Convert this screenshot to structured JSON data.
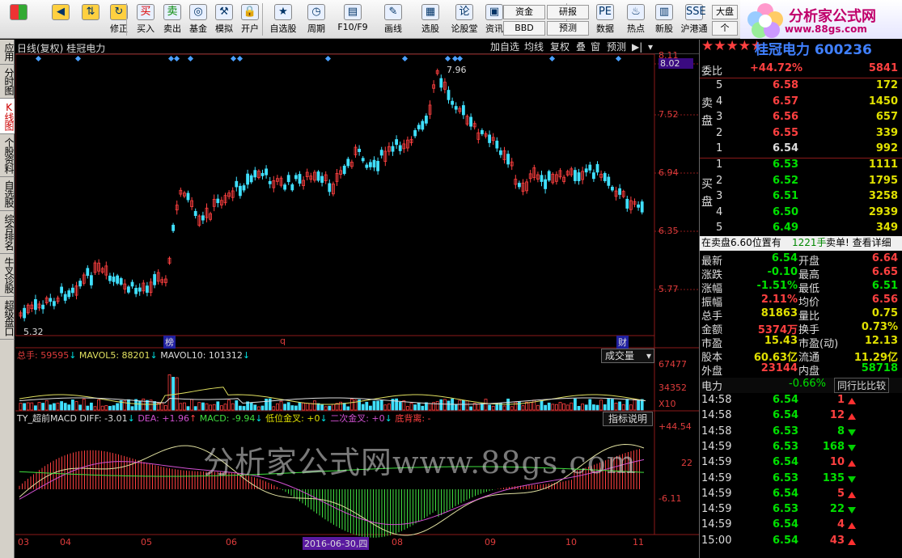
{
  "toolbar": {
    "buttons": [
      {
        "label": "",
        "icon": "app-icon"
      },
      {
        "label": "",
        "icon": "back-icon"
      },
      {
        "label": "",
        "icon": "up-down-icon"
      },
      {
        "label": "修正",
        "icon": "refresh-icon"
      },
      {
        "label": "买入",
        "icon": "buy-icon",
        "glyph": "买"
      },
      {
        "label": "卖出",
        "icon": "sell-icon",
        "glyph": "卖"
      },
      {
        "label": "基金",
        "icon": "fund-icon",
        "glyph": "◎"
      },
      {
        "label": "模拟",
        "icon": "hammer-icon",
        "glyph": "⚒"
      },
      {
        "label": "开户",
        "icon": "lock-icon",
        "glyph": "🔒"
      },
      {
        "label": "自选股",
        "icon": "star-icon",
        "glyph": "★"
      },
      {
        "label": "周期",
        "icon": "clock-icon",
        "glyph": "◷"
      },
      {
        "label": "F10/F9",
        "icon": "f10-icon",
        "glyph": "▤"
      },
      {
        "label": "画线",
        "icon": "pen-icon",
        "glyph": "✎"
      },
      {
        "label": "选股",
        "icon": "screen-icon",
        "glyph": "▦"
      },
      {
        "label": "论股堂",
        "icon": "discuss-icon",
        "glyph": "论"
      },
      {
        "label": "资讯",
        "icon": "news-icon",
        "glyph": "▣"
      },
      {
        "label": "数据",
        "icon": "pe-icon",
        "glyph": "PE"
      },
      {
        "label": "热点",
        "icon": "hot-icon",
        "glyph": "♨"
      },
      {
        "label": "新股",
        "icon": "newstock-icon",
        "glyph": "▥"
      },
      {
        "label": "沪港通",
        "icon": "hkconnect-icon",
        "glyph": "SSE"
      }
    ],
    "small_buttons": [
      "资金",
      "BBD",
      "研报",
      "预测",
      "大盘",
      "个"
    ]
  },
  "logo": {
    "line1": "分析家公式网",
    "line2": "www.88gs.com"
  },
  "sidebar": {
    "tabs": [
      "应用",
      "分时图",
      "K线图",
      "个股资料",
      "自选股",
      "综合排名",
      "牛叉诊股",
      "超级盘口"
    ]
  },
  "chart": {
    "title": "日线(复权)",
    "stock_name": "桂冠电力",
    "header_buttons": [
      "加自选",
      "均线",
      "复权",
      "叠",
      "窗",
      "预测"
    ],
    "price_axis": [
      "8.11",
      "8.02",
      "7.52",
      "6.94",
      "6.35",
      "5.77"
    ],
    "high_label": "7.96",
    "low_label": "5.32",
    "markers": [
      "榜",
      "q",
      "财"
    ],
    "volume": {
      "zong_label": "总手: 59595",
      "mavol5_label": "MAVOL5: 88201",
      "mavol10_label": "MAVOL10: 101312",
      "indicator": "成交量",
      "axis": [
        "67477",
        "34352",
        "X10"
      ]
    },
    "macd": {
      "name": "TY_超前MACD",
      "diff": "DIFF: -3.01",
      "dea": "DEA: +1.96",
      "macd": "MACD: -9.94",
      "low_gold": "低位金叉: +0",
      "second_gold": "二次金叉: +0",
      "bottom_div": "底背离: -",
      "help": "指标说明",
      "axis": [
        "+44.54",
        "-6.11"
      ],
      "axis_mid": "22"
    },
    "watermark": "分析家公式网www.88gs.com",
    "dates": [
      "03",
      "04",
      "05",
      "06",
      "2016-06-30,四",
      "08",
      "09",
      "10",
      "11"
    ]
  },
  "quote": {
    "stars": "★★★★★",
    "title": "桂冠电力 600236",
    "weibi_label": "委比",
    "weibi_val": "+44.72%",
    "weibi_diff": "5841",
    "sell_label": "卖盘",
    "sells": [
      {
        "n": "5",
        "p": "6.58",
        "v": "172"
      },
      {
        "n": "4",
        "p": "6.57",
        "v": "1450"
      },
      {
        "n": "3",
        "p": "6.56",
        "v": "657"
      },
      {
        "n": "2",
        "p": "6.55",
        "v": "339"
      },
      {
        "n": "1",
        "p": "6.54",
        "v": "992"
      }
    ],
    "buy_label": "买盘",
    "buys": [
      {
        "n": "1",
        "p": "6.53",
        "v": "1111"
      },
      {
        "n": "2",
        "p": "6.52",
        "v": "1795"
      },
      {
        "n": "3",
        "p": "6.51",
        "v": "3258"
      },
      {
        "n": "4",
        "p": "6.50",
        "v": "2939"
      },
      {
        "n": "5",
        "p": "6.49",
        "v": "349"
      }
    ],
    "notice": "在卖盘6.60位置有",
    "notice_hand": "1221手",
    "notice_link": "卖单! 查看详细",
    "stats": [
      {
        "l": "最新",
        "v": "6.54",
        "l2": "开盘",
        "v2": "6.64"
      },
      {
        "l": "涨跌",
        "v": "-0.10",
        "l2": "最高",
        "v2": "6.65"
      },
      {
        "l": "涨幅",
        "v": "-1.51%",
        "l2": "最低",
        "v2": "6.51"
      },
      {
        "l": "振幅",
        "v": "2.11%",
        "l2": "均价",
        "v2": "6.56"
      },
      {
        "l": "总手",
        "v": "81863",
        "l2": "量比",
        "v2": "0.75"
      },
      {
        "l": "金额",
        "v": "5374万",
        "l2": "换手",
        "v2": "0.73%"
      },
      {
        "l": "市盈",
        "v": "15.43",
        "l2": "市盈(动)",
        "v2": "12.13"
      },
      {
        "l": "股本",
        "v": "60.63亿",
        "l2": "流通",
        "v2": "11.29亿"
      },
      {
        "l": "外盘",
        "v": "23144",
        "l2": "内盘",
        "v2": "58718"
      }
    ],
    "sector": "电力",
    "sector_chg": "-0.66%",
    "compare_btn": "同行比比较",
    "ticks": [
      {
        "t": "14:58",
        "p": "6.54",
        "v": "1",
        "d": "up"
      },
      {
        "t": "14:58",
        "p": "6.54",
        "v": "12",
        "d": "up"
      },
      {
        "t": "14:58",
        "p": "6.53",
        "v": "8",
        "d": "down"
      },
      {
        "t": "14:59",
        "p": "6.53",
        "v": "168",
        "d": "down"
      },
      {
        "t": "14:59",
        "p": "6.54",
        "v": "10",
        "d": "up"
      },
      {
        "t": "14:59",
        "p": "6.53",
        "v": "135",
        "d": "down"
      },
      {
        "t": "14:59",
        "p": "6.54",
        "v": "5",
        "d": "up"
      },
      {
        "t": "14:59",
        "p": "6.53",
        "v": "22",
        "d": "down"
      },
      {
        "t": "14:59",
        "p": "6.54",
        "v": "4",
        "d": "up"
      },
      {
        "t": "15:00",
        "p": "6.54",
        "v": "43",
        "d": "up"
      }
    ]
  }
}
